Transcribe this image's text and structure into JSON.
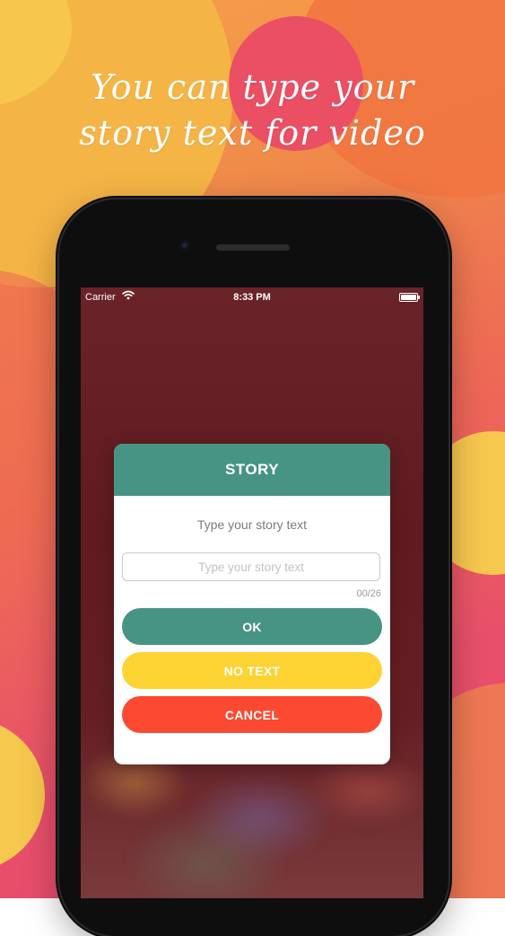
{
  "headline": {
    "line1": "You can type your",
    "line2": "story text for video"
  },
  "status_bar": {
    "carrier": "Carrier",
    "time": "8:33 PM",
    "wifi_icon": "wifi-icon",
    "battery_icon": "battery-icon"
  },
  "dialog": {
    "title": "STORY",
    "subtitle": "Type your story text",
    "input_value": "",
    "input_placeholder": "Type your story text",
    "counter": "00/26",
    "ok_label": "OK",
    "no_text_label": "NO TEXT",
    "cancel_label": "CANCEL"
  },
  "colors": {
    "header": "#479485",
    "ok": "#479485",
    "no_text": "#fdd334",
    "cancel": "#fb4a31"
  }
}
